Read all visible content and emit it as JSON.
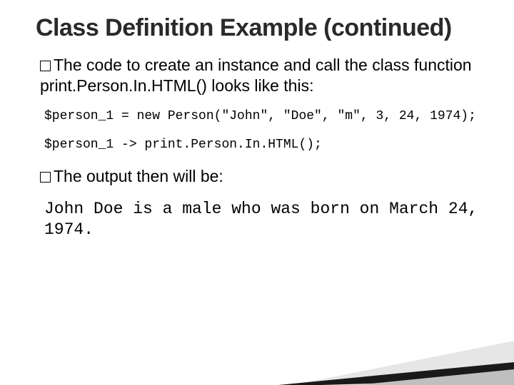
{
  "title": "Class Definition Example (continued)",
  "para1_prefix": "The",
  "para1_rest": " code to create an instance and call the class function print.Person.In.HTML() looks like this:",
  "code1": "$person_1 = new Person(\"John\", \"Doe\", \"m\", 3, 24, 1974);",
  "code2": "$person_1 -> print.Person.In.HTML();",
  "para2_prefix": "The",
  "para2_rest": " output then will be:",
  "output": "John Doe is a male who was born on March 24, 1974."
}
